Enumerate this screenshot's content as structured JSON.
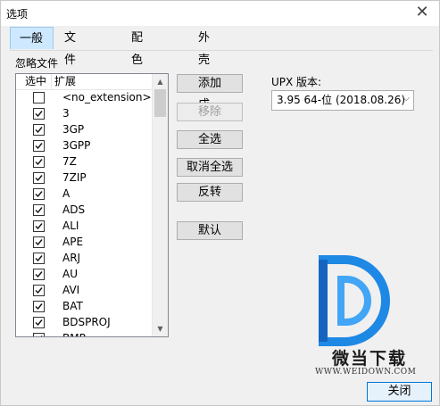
{
  "window": {
    "title": "选项"
  },
  "tabs": [
    {
      "label": "一般"
    },
    {
      "label": "文件列表"
    },
    {
      "label": "配色方案"
    },
    {
      "label": "外壳集成"
    }
  ],
  "ignore_files": {
    "label": "忽略文件",
    "columns": {
      "selected": "选中",
      "extension": "扩展"
    },
    "items": [
      {
        "ext": "<no_extension>",
        "checked": false
      },
      {
        "ext": "3",
        "checked": true
      },
      {
        "ext": "3GP",
        "checked": true
      },
      {
        "ext": "3GPP",
        "checked": true
      },
      {
        "ext": "7Z",
        "checked": true
      },
      {
        "ext": "7ZIP",
        "checked": true
      },
      {
        "ext": "A",
        "checked": true
      },
      {
        "ext": "ADS",
        "checked": true
      },
      {
        "ext": "ALI",
        "checked": true
      },
      {
        "ext": "APE",
        "checked": true
      },
      {
        "ext": "ARJ",
        "checked": true
      },
      {
        "ext": "AU",
        "checked": true
      },
      {
        "ext": "AVI",
        "checked": true
      },
      {
        "ext": "BAT",
        "checked": true
      },
      {
        "ext": "BDSPROJ",
        "checked": true
      },
      {
        "ext": "BMP",
        "checked": true
      }
    ]
  },
  "buttons": {
    "add": "添加",
    "remove": "移除",
    "select_all": "全选",
    "deselect_all": "取消全选",
    "invert": "反转",
    "default": "默认",
    "close": "关闭"
  },
  "upx": {
    "label": "UPX 版本:",
    "selected": "3.95 64-位 (2018.08.26)"
  },
  "watermark": {
    "name": "微当下载",
    "url": "WWW.WEIDOWN.COM"
  },
  "colors": {
    "tab_active_bg": "#cde8ff",
    "logo_blue": "#1e88e5",
    "default_button_border": "#0078d7"
  }
}
